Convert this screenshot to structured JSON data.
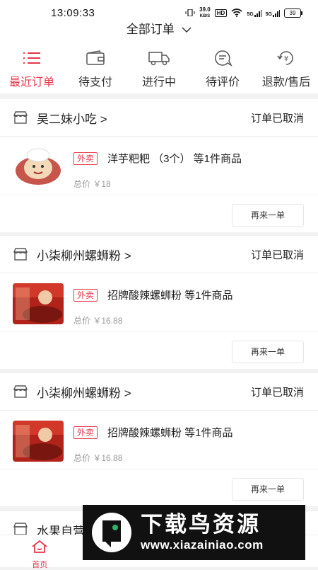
{
  "status_bar": {
    "time": "13:09:33",
    "net_speed_value": "39.0",
    "net_speed_unit": "KB/S",
    "hd": "HD",
    "signal1": "5G",
    "signal2": "5G",
    "battery": "39"
  },
  "header": {
    "title": "全部订单"
  },
  "tabs": [
    {
      "label": "最近订单",
      "icon": "list-icon",
      "active": true
    },
    {
      "label": "待支付",
      "icon": "wallet-icon",
      "active": false
    },
    {
      "label": "进行中",
      "icon": "truck-icon",
      "active": false
    },
    {
      "label": "待评价",
      "icon": "review-icon",
      "active": false
    },
    {
      "label": "退款/售后",
      "icon": "refund-icon",
      "active": false
    }
  ],
  "orders": [
    {
      "shop": "吴二妹小吃 >",
      "status": "订单已取消",
      "tag": "外卖",
      "item": "洋芋粑粑 （3个） 等1件商品",
      "price": "总价 ￥18",
      "action": "再来一单"
    },
    {
      "shop": "小柒柳州螺蛳粉 >",
      "status": "订单已取消",
      "tag": "外卖",
      "item": "招牌酸辣螺蛳粉 等1件商品",
      "price": "总价 ￥16.88",
      "action": "再来一单"
    },
    {
      "shop": "小柒柳州螺蛳粉 >",
      "status": "订单已取消",
      "tag": "外卖",
      "item": "招牌酸辣螺蛳粉 等1件商品",
      "price": "总价 ￥16.88",
      "action": "再来一单"
    },
    {
      "shop": "水果自营"
    }
  ],
  "bottom_nav": [
    {
      "label": "首页",
      "icon": "home-icon",
      "active": true
    },
    {
      "label": "",
      "icon": "nav-2-icon",
      "active": false
    },
    {
      "label": "",
      "icon": "nav-3-icon",
      "active": false
    },
    {
      "label": "",
      "icon": "nav-4-icon",
      "active": false
    }
  ],
  "watermark": {
    "title": "下载鸟资源",
    "url": "www.xiazainiao.com"
  },
  "colors": {
    "accent": "#e5374b",
    "background": "#f2f2f2"
  }
}
